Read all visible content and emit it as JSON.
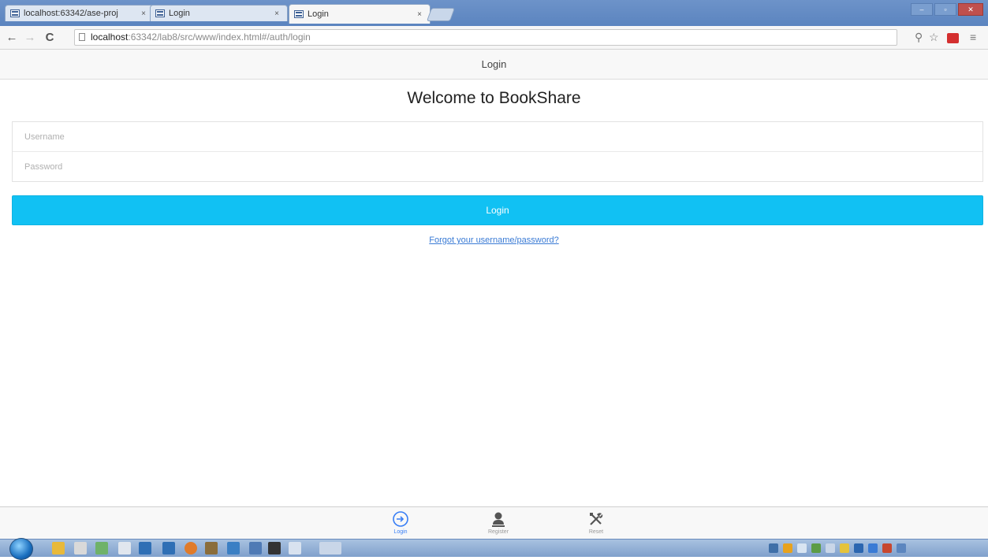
{
  "browser": {
    "tabs": [
      {
        "label": "localhost:63342/ase-proj",
        "active": false
      },
      {
        "label": "Login",
        "active": false
      },
      {
        "label": "Login",
        "active": true
      }
    ],
    "tab_close": "×",
    "address": {
      "host": "localhost",
      "path": ":63342/lab8/src/www/index.html#/auth/login"
    },
    "nav": {
      "back": "←",
      "forward": "→",
      "reload": "C"
    },
    "menu_icon": "≡"
  },
  "app": {
    "header_title": "Login",
    "welcome": "Welcome to BookShare",
    "username_placeholder": "Username",
    "password_placeholder": "Password",
    "login_button": "Login",
    "forgot_link": "Forgot your username/password?"
  },
  "tabbar": {
    "items": [
      {
        "label": "Login",
        "icon": "login-icon",
        "active": true
      },
      {
        "label": "Register",
        "icon": "person-icon",
        "active": false
      },
      {
        "label": "Reset",
        "icon": "tools-icon",
        "active": false
      }
    ]
  },
  "colors": {
    "accent": "#11c1f3",
    "link": "#3a7bd5",
    "tab_active": "#387ef5"
  }
}
